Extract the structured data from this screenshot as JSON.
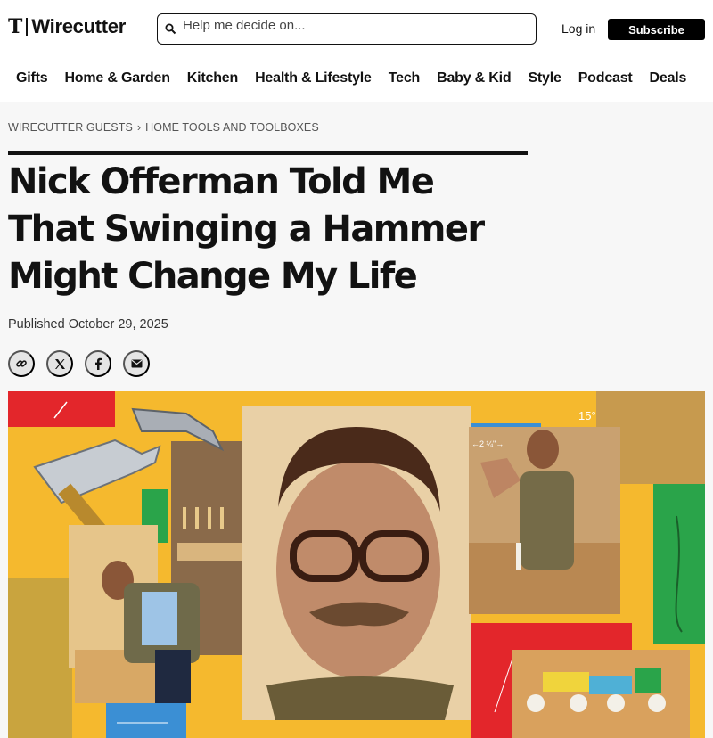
{
  "header": {
    "logo_mark": "T",
    "logo_word": "Wirecutter",
    "search_placeholder": "Help me decide on...",
    "login_label": "Log in",
    "subscribe_label": "Subscribe"
  },
  "nav": {
    "items": [
      "Gifts",
      "Home & Garden",
      "Kitchen",
      "Health & Lifestyle",
      "Tech",
      "Baby & Kid",
      "Style",
      "Podcast",
      "Deals"
    ]
  },
  "breadcrumb": {
    "section": "WIRECUTTER GUESTS",
    "separator": "›",
    "subsection": "HOME TOOLS AND TOOLBOXES"
  },
  "article": {
    "headline_lines": [
      "Nick Offerman Told Me",
      "That Swinging a Hammer",
      "Might Change My Life"
    ],
    "published": "Published October 29, 2025"
  },
  "share": {
    "icons": [
      "link-icon",
      "x-icon",
      "facebook-icon",
      "email-icon"
    ]
  },
  "hero": {
    "background_color": "#f5b92e",
    "annotations": [
      "15°",
      "←2 ¼\"→"
    ]
  },
  "colors": {
    "text": "#121212",
    "page_bg": "#f7f7f7",
    "subscribe_bg": "#000000",
    "hero_yellow": "#f5b92e",
    "hero_red": "#e3262b",
    "hero_green": "#2aa44a",
    "hero_blue": "#3b8fd4"
  }
}
